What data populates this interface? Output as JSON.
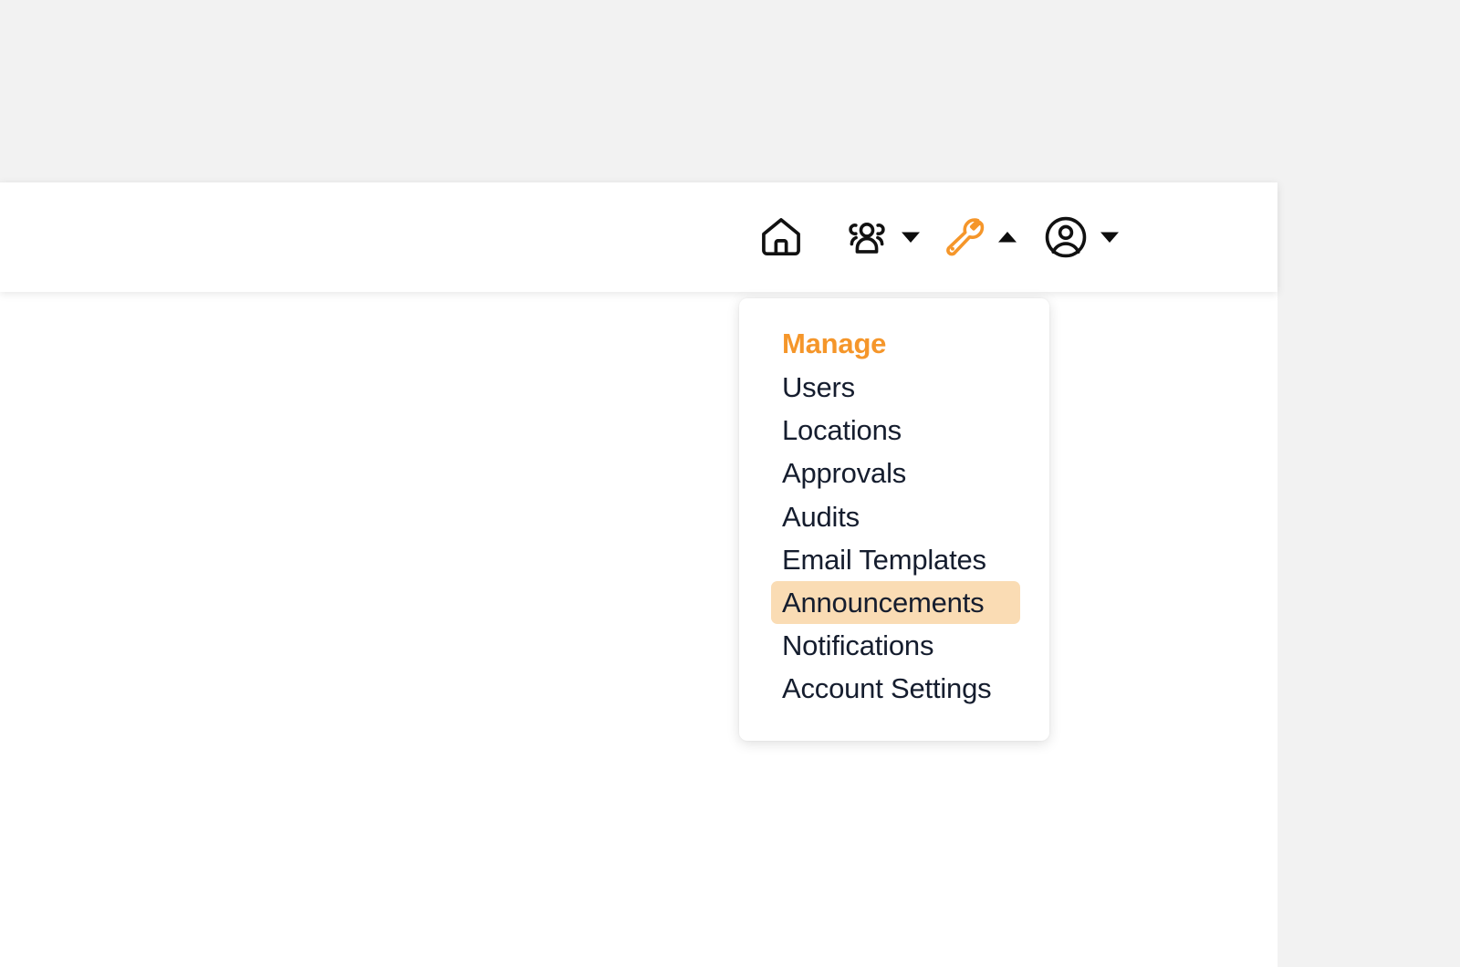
{
  "theme": {
    "accent_orange": "#f5962a",
    "highlight_bg": "#fadcb4",
    "text_dark": "#151d2e",
    "page_bg": "#f2f2f2",
    "panel_bg": "#ffffff"
  },
  "navbar": {
    "items": [
      {
        "icon": "home-icon",
        "label": "Home",
        "has_caret": false,
        "caret": null,
        "color": "#111111"
      },
      {
        "icon": "people-group-icon",
        "label": "People",
        "has_caret": true,
        "caret": "chevron-down-icon",
        "color": "#111111"
      },
      {
        "icon": "wrench-icon",
        "label": "Manage",
        "has_caret": true,
        "caret": "chevron-up-icon",
        "color": "#f5962a"
      },
      {
        "icon": "user-circle-icon",
        "label": "Account",
        "has_caret": true,
        "caret": "chevron-down-icon",
        "color": "#111111"
      }
    ]
  },
  "dropdown": {
    "heading": "Manage",
    "items": [
      {
        "label": "Users",
        "highlighted": false
      },
      {
        "label": "Locations",
        "highlighted": false
      },
      {
        "label": "Approvals",
        "highlighted": false
      },
      {
        "label": "Audits",
        "highlighted": false
      },
      {
        "label": "Email Templates",
        "highlighted": false
      },
      {
        "label": "Announcements",
        "highlighted": true
      },
      {
        "label": "Notifications",
        "highlighted": false
      },
      {
        "label": "Account Settings",
        "highlighted": false
      }
    ]
  }
}
